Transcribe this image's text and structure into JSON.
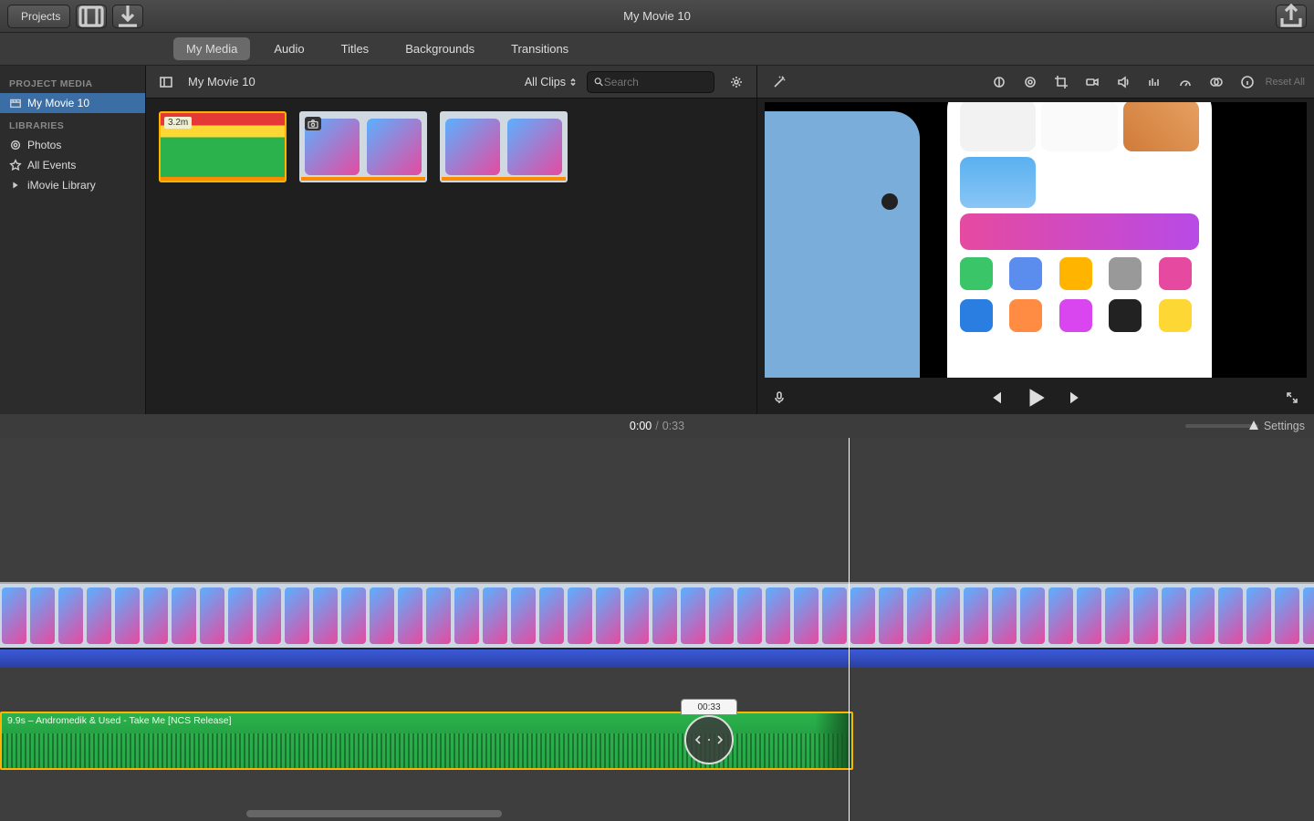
{
  "app_title": "My Movie 10",
  "toolbar": {
    "projects_label": "Projects",
    "reset_all": "Reset All"
  },
  "tabs": [
    {
      "label": "My Media",
      "active": true
    },
    {
      "label": "Audio"
    },
    {
      "label": "Titles"
    },
    {
      "label": "Backgrounds"
    },
    {
      "label": "Transitions"
    }
  ],
  "sidebar": {
    "project_header": "PROJECT MEDIA",
    "project_item": "My Movie 10",
    "libraries_header": "LIBRARIES",
    "photos": "Photos",
    "all_events": "All Events",
    "imovie_library": "iMovie Library"
  },
  "media_header": {
    "project_name": "My Movie 10",
    "filter": "All Clips",
    "search_placeholder": "Search"
  },
  "clips": {
    "clip1_badge": "3.2m"
  },
  "time": {
    "current": "0:00",
    "total": "0:33",
    "settings": "Settings"
  },
  "audio_clip": {
    "label": "9.9s – Andromedik & Used - Take Me [NCS Release]",
    "trim_tooltip": "00:33"
  }
}
